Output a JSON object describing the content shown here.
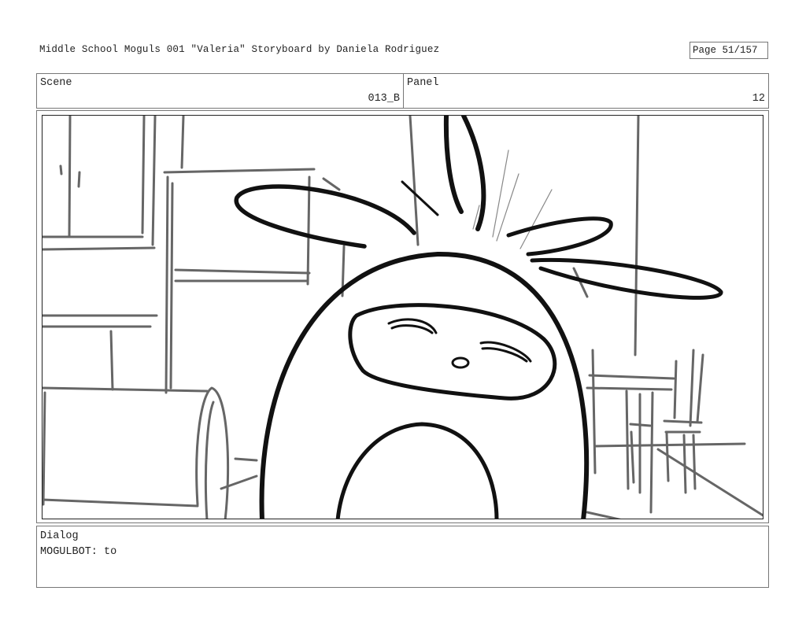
{
  "header": {
    "title": "Middle School Moguls 001 \"Valeria\"  Storyboard  by Daniela Rodriguez",
    "page": "Page  51/157"
  },
  "scene": {
    "label": "Scene",
    "value": "013_B"
  },
  "panel": {
    "label": "Panel",
    "value": "12"
  },
  "dialog": {
    "label": "Dialog",
    "text": "MOGULBOT: to"
  }
}
